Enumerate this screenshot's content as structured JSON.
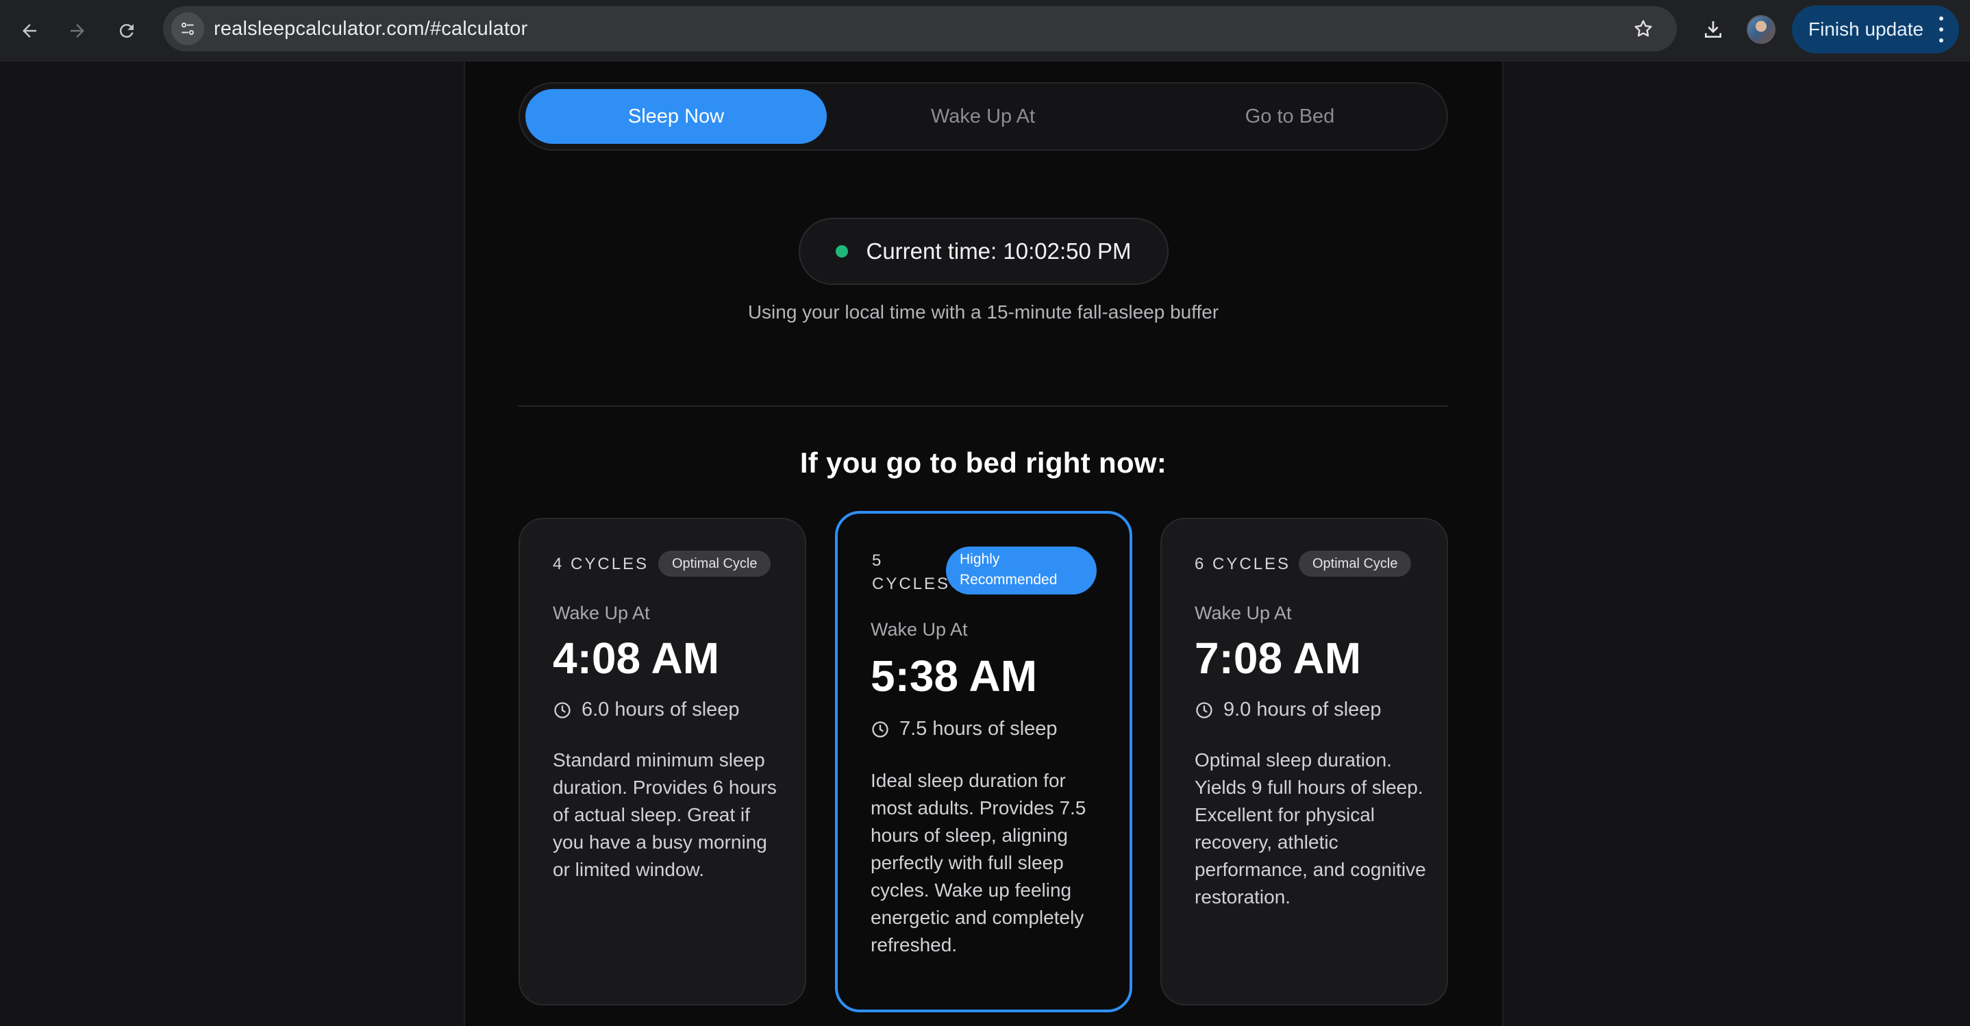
{
  "browser": {
    "url": "realsleepcalculator.com/#calculator",
    "update_label": "Finish update",
    "icons": [
      "back-arrow-icon",
      "forward-arrow-icon",
      "reload-icon",
      "site-info-icon",
      "star-icon",
      "download-icon",
      "avatar",
      "more-vert-icon"
    ]
  },
  "tabs": [
    {
      "label": "Sleep Now",
      "active": true
    },
    {
      "label": "Wake Up At",
      "active": false
    },
    {
      "label": "Go to Bed",
      "active": false
    }
  ],
  "current_time": {
    "label": "Current time: 10:02:50 PM",
    "note": "Using your local time with a 15-minute fall-asleep buffer"
  },
  "heading": "If you go to bed right now:",
  "cards": [
    {
      "cycles": "4 CYCLES",
      "badge": "Optimal Cycle",
      "wake_label": "Wake Up At",
      "wake_time": "4:08 AM",
      "hours": "6.0 hours of sleep",
      "description": "Standard minimum sleep duration. Provides 6 hours of actual sleep. Great if you have a busy morning or limited window."
    },
    {
      "cycles": "5 CYCLES",
      "badge": "Highly Recommended",
      "wake_label": "Wake Up At",
      "wake_time": "5:38 AM",
      "hours": "7.5 hours of sleep",
      "description": "Ideal sleep duration for most adults. Provides 7.5 hours of sleep, aligning perfectly with full sleep cycles. Wake up feeling energetic and completely refreshed."
    },
    {
      "cycles": "6 CYCLES",
      "badge": "Optimal Cycle",
      "wake_label": "Wake Up At",
      "wake_time": "7:08 AM",
      "hours": "9.0 hours of sleep",
      "description": "Optimal sleep duration. Yields 9 full hours of sleep. Excellent for physical recovery, athletic performance, and cognitive restoration."
    }
  ],
  "colors": {
    "accent": "#2f8ff5",
    "status_dot": "#1fb879",
    "page_bg": "#0b0b0c"
  }
}
